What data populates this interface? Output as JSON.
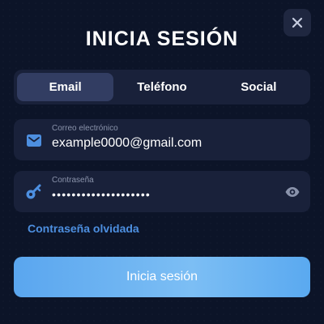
{
  "modal": {
    "title": "INICIA SESIÓN",
    "close_icon": "close-icon"
  },
  "tabs": [
    {
      "label": "Email",
      "active": true
    },
    {
      "label": "Teléfono",
      "active": false
    },
    {
      "label": "Social",
      "active": false
    }
  ],
  "email_field": {
    "label": "Correo electrónico",
    "value": "example0000@gmail.com",
    "icon": "mail-icon"
  },
  "password_field": {
    "label": "Contraseña",
    "value": "••••••••••••••••••••",
    "icon": "key-icon",
    "toggle_icon": "eye-icon"
  },
  "forgot_link": "Contraseña olvidada",
  "submit_label": "Inicia sesión",
  "colors": {
    "background": "#0c1428",
    "field_bg": "#19213a",
    "active_tab": "#323d62",
    "accent": "#4d8fe0",
    "button": "#6fb5f2"
  }
}
